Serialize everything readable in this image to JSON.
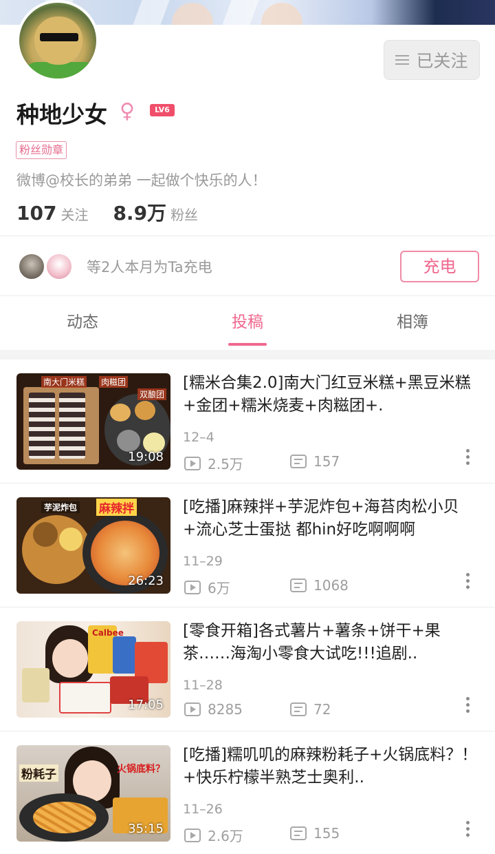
{
  "profile": {
    "name": "种地少女",
    "gender_symbol": "♀",
    "level": "LV6",
    "badge": "粉丝勋章",
    "bio": "微博@校长的弟弟  一起做个快乐的人！",
    "follow_button": "已关注",
    "stats": [
      {
        "value": "107",
        "label": "关注"
      },
      {
        "value": "8.9万",
        "label": "粉丝"
      }
    ]
  },
  "charge": {
    "text": "等2人本月为Ta充电",
    "button": "充电"
  },
  "tabs": [
    {
      "label": "动态",
      "active": false
    },
    {
      "label": "投稿",
      "active": true
    },
    {
      "label": "相簿",
      "active": false
    }
  ],
  "videos": [
    {
      "title": "[糯米合集2.0]南大门红豆米糕+黑豆米糕+金团+糯米烧麦+肉糍团+.",
      "date": "12–4",
      "duration": "19:08",
      "views": "2.5万",
      "danmaku": "157",
      "thumb_labels": [
        "南大门米糕",
        "肉糍团",
        "双酿团"
      ]
    },
    {
      "title": "[吃播]麻辣拌+芋泥炸包+海苔肉松小贝+流心芝士蛋挞  都hin好吃啊啊啊",
      "date": "11–29",
      "duration": "26:23",
      "views": "6万",
      "danmaku": "1068",
      "thumb_labels": [
        "芋泥炸包",
        "麻辣拌"
      ]
    },
    {
      "title": "[零食开箱]各式薯片+薯条+饼干+果茶……海淘小零食大试吃!!!追剧..",
      "date": "11–28",
      "duration": "17:05",
      "views": "8285",
      "danmaku": "72",
      "thumb_labels": [
        "Calbee"
      ]
    },
    {
      "title": "[吃播]糯叽叽的麻辣粉耗子+火锅底料？！+快乐柠檬半熟芝士奥利..",
      "date": "11–26",
      "duration": "35:15",
      "views": "2.6万",
      "danmaku": "155",
      "thumb_labels": [
        "粉耗子",
        "火锅底料？"
      ]
    }
  ],
  "icons": {
    "follow": "hamburger-icon",
    "gender": "female-icon",
    "views": "play-count-icon",
    "danmaku": "danmaku-icon",
    "more": "more-vertical-icon"
  },
  "colors": {
    "accent": "#f0678e",
    "level": "#f04e6a",
    "muted": "#9e9e9e"
  }
}
